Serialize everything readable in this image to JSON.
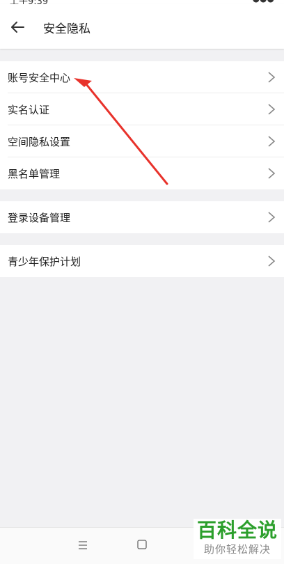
{
  "header": {
    "title": "安全隐私",
    "back_icon": "arrow-left-icon"
  },
  "groups": [
    {
      "items": [
        {
          "label": "账号安全中心",
          "icon": "chevron-right-icon"
        },
        {
          "label": "实名认证",
          "icon": "chevron-right-icon"
        },
        {
          "label": "空间隐私设置",
          "icon": "chevron-right-icon"
        },
        {
          "label": "黑名单管理",
          "icon": "chevron-right-icon"
        }
      ]
    },
    {
      "items": [
        {
          "label": "登录设备管理",
          "icon": "chevron-right-icon"
        }
      ]
    },
    {
      "items": [
        {
          "label": "青少年保护计划",
          "icon": "chevron-right-icon"
        }
      ]
    }
  ],
  "annotation": {
    "color": "#e8322b"
  },
  "navbar": {
    "icons": [
      "menu-icon",
      "home-square-icon"
    ]
  },
  "watermark": {
    "line1": "百科全说",
    "line2": "助你轻松解决",
    "color": "#2c9f2c"
  }
}
